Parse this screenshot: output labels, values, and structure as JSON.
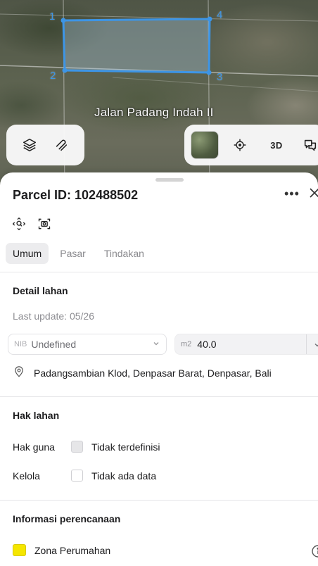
{
  "map": {
    "street_label": "Jalan Padang Indah II",
    "vertex_labels": [
      "1",
      "2",
      "3",
      "4"
    ],
    "parcel_color": "#3d95e6",
    "left_controls": [
      {
        "name": "layers-icon"
      },
      {
        "name": "measure-icon"
      }
    ],
    "right_controls": {
      "thumbnail": "satellite-thumbnail",
      "locate": "crosshair-icon",
      "three_d_label": "3D",
      "feedback": "chat-icon"
    }
  },
  "sheet": {
    "title": "Parcel ID: 102488502",
    "more_label": "•••",
    "tabs": [
      {
        "label": "Umum",
        "active": true
      },
      {
        "label": "Pasar",
        "active": false
      },
      {
        "label": "Tindakan",
        "active": false
      }
    ],
    "detail": {
      "heading": "Detail lahan",
      "last_update": "Last update: 05/26",
      "nib_prefix": "NIB",
      "nib_value": "Undefined",
      "area_prefix": "m2",
      "area_value": "40.0",
      "address": "Padangsambian Klod, Denpasar Barat, Denpasar, Bali"
    },
    "hak": {
      "heading": "Hak lahan",
      "rows": [
        {
          "label": "Hak guna",
          "value": "Tidak terdefinisi",
          "filled": true
        },
        {
          "label": "Kelola",
          "value": "Tidak ada data",
          "filled": false
        }
      ]
    },
    "planning": {
      "heading": "Informasi perencanaan",
      "zone_label": "Zona Perumahan",
      "zone_color": "#f5e600"
    }
  }
}
